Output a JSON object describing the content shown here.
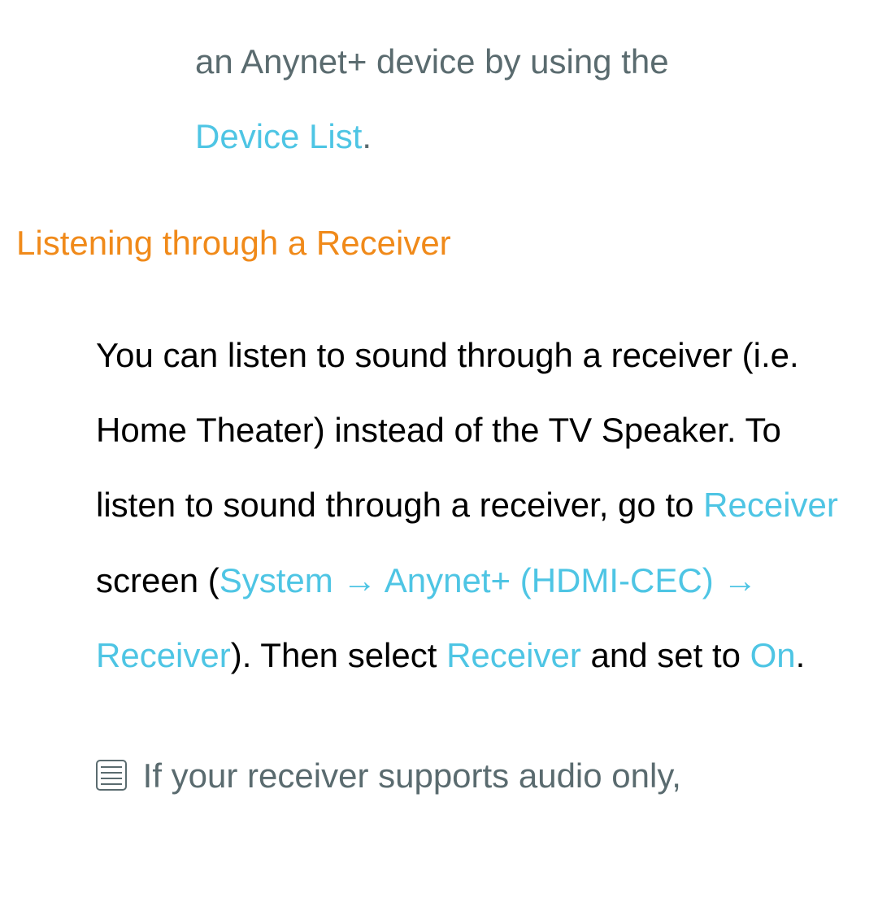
{
  "intro": {
    "line1": "an Anynet+ device by using the ",
    "device_list": "Device List",
    "period": "."
  },
  "heading": "Listening through a Receiver",
  "body": {
    "p1_seg1": "You can listen to sound through a receiver (i.e. Home Theater) instead of the TV Speaker. To listen to sound through a receiver, go to ",
    "receiver1": "Receiver",
    "p1_seg2": " screen (",
    "system": "System",
    "arrow1": " → ",
    "anynet": "Anynet+ (HDMI-CEC)",
    "arrow2": " → ",
    "receiver2": "Receiver",
    "p1_seg3": "). Then select ",
    "receiver3": "Receiver",
    "p1_seg4": " and set to ",
    "on": "On",
    "p1_seg5": "."
  },
  "note": {
    "text": " If your receiver supports audio only,"
  }
}
